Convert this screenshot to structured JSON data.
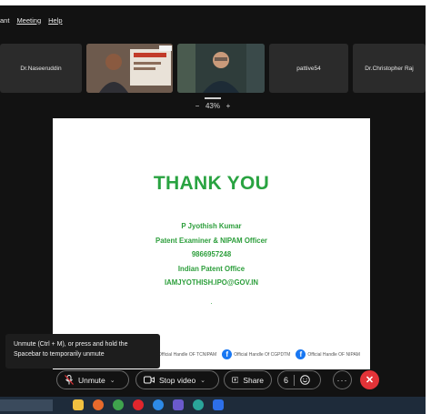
{
  "menu": {
    "items": [
      "ant",
      "Meeting",
      "Help"
    ]
  },
  "participants": [
    {
      "name": "Dr.Naseeruddin"
    },
    {
      "name": "",
      "type": "video-slide"
    },
    {
      "name": "",
      "type": "video-person"
    },
    {
      "name": "pattive54"
    },
    {
      "name": "Dr.Christopher Raj"
    }
  ],
  "zoom": {
    "minus": "−",
    "value": "43%",
    "plus": "+"
  },
  "slide": {
    "title": "THANK YOU",
    "lines": [
      "P Jyothish Kumar",
      "Patent Examiner & NIPAM Officer",
      "9866957248",
      "Indian Patent Office",
      "IAMJYOTHISH.IPO@GOV.IN"
    ],
    "dot": ".",
    "social": [
      "Official Handle OF TCNIPAM",
      "Official Handle Of CGPDTM",
      "Official Handle OF NIPAM"
    ],
    "colors": {
      "title": "#29a341",
      "text": "#2c9e3b"
    }
  },
  "tooltip": {
    "text": "Unmute (Ctrl + M), or press and hold the Spacebar to temporarily unmute"
  },
  "controls": {
    "unmute": "Unmute",
    "stop_video": "Stop video",
    "share": "Share",
    "reactions_count": "6"
  },
  "colors": {
    "end_call": "#e23338",
    "background": "#121212"
  }
}
